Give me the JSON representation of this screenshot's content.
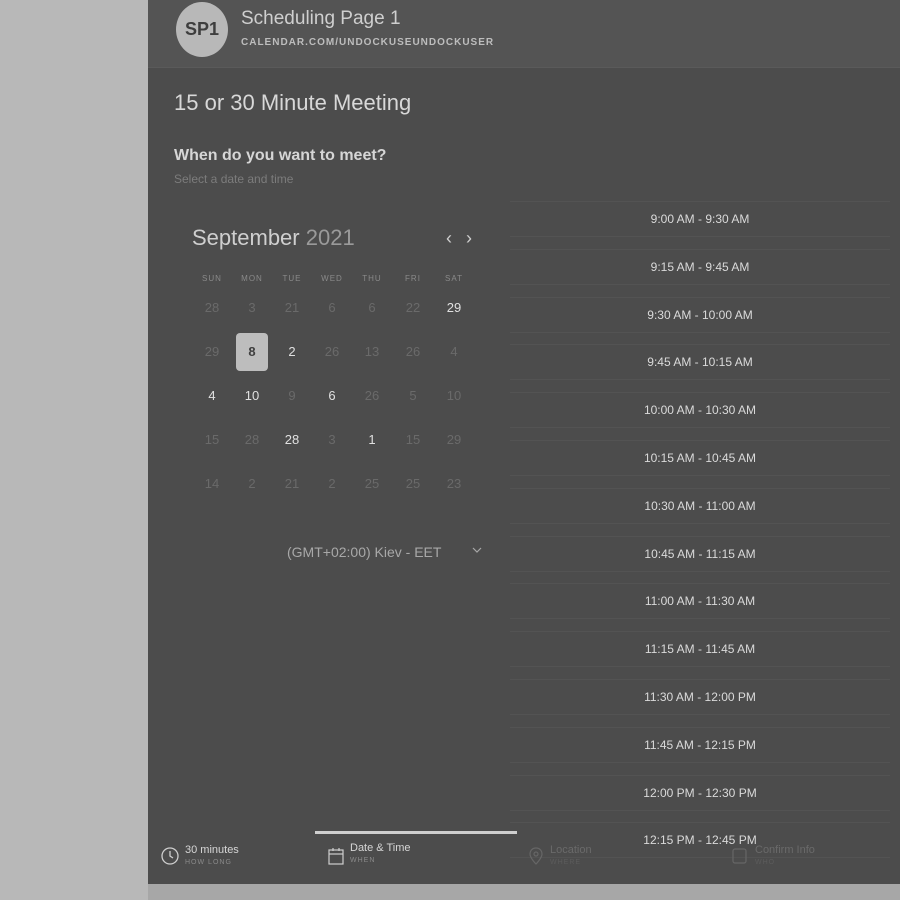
{
  "header": {
    "avatar_initials": "SP1",
    "page_name": "Scheduling Page 1",
    "page_url": "CALENDAR.COM/UNDOCKUSEUNDOCKUSER"
  },
  "meeting": {
    "title": "15 or 30 Minute Meeting",
    "question": "When do you want to meet?",
    "hint": "Select a date and time"
  },
  "calendar": {
    "month": "September",
    "year": "2021",
    "weekdays": [
      "SUN",
      "MON",
      "TUE",
      "WED",
      "THU",
      "FRI",
      "SAT"
    ],
    "weeks": [
      [
        "28",
        "3",
        "21",
        "6",
        "6",
        "22",
        "29"
      ],
      [
        "29",
        "8",
        "2",
        "26",
        "13",
        "26",
        "4"
      ],
      [
        "4",
        "10",
        "9",
        "6",
        "26",
        "5",
        "10"
      ],
      [
        "15",
        "28",
        "28",
        "3",
        "1",
        "15",
        "29"
      ],
      [
        "14",
        "2",
        "21",
        "2",
        "25",
        "25",
        "23"
      ]
    ],
    "timezone": "(GMT+02:00) Kiev - EET"
  },
  "time_slots": [
    "9:00 AM - 9:30 AM",
    "9:15 AM - 9:45 AM",
    "9:30 AM - 10:00 AM",
    "9:45 AM - 10:15 AM",
    "10:00 AM - 10:30 AM",
    "10:15 AM - 10:45 AM",
    "10:30 AM - 11:00 AM",
    "10:45 AM - 11:15 AM",
    "11:00 AM - 11:30 AM",
    "11:15 AM - 11:45 AM",
    "11:30 AM - 12:00 PM",
    "11:45 AM - 12:15 PM",
    "12:00 PM - 12:30 PM",
    "12:15 PM - 12:45 PM"
  ],
  "steps": [
    {
      "label": "30 minutes",
      "sub": "HOW LONG",
      "icon": "clock-icon"
    },
    {
      "label": "Date & Time",
      "sub": "WHEN",
      "icon": "calendar-icon"
    },
    {
      "label": "Location",
      "sub": "WHERE",
      "icon": "location-pin-icon"
    },
    {
      "label": "Confirm Info",
      "sub": "WHO",
      "icon": "document-icon"
    }
  ]
}
